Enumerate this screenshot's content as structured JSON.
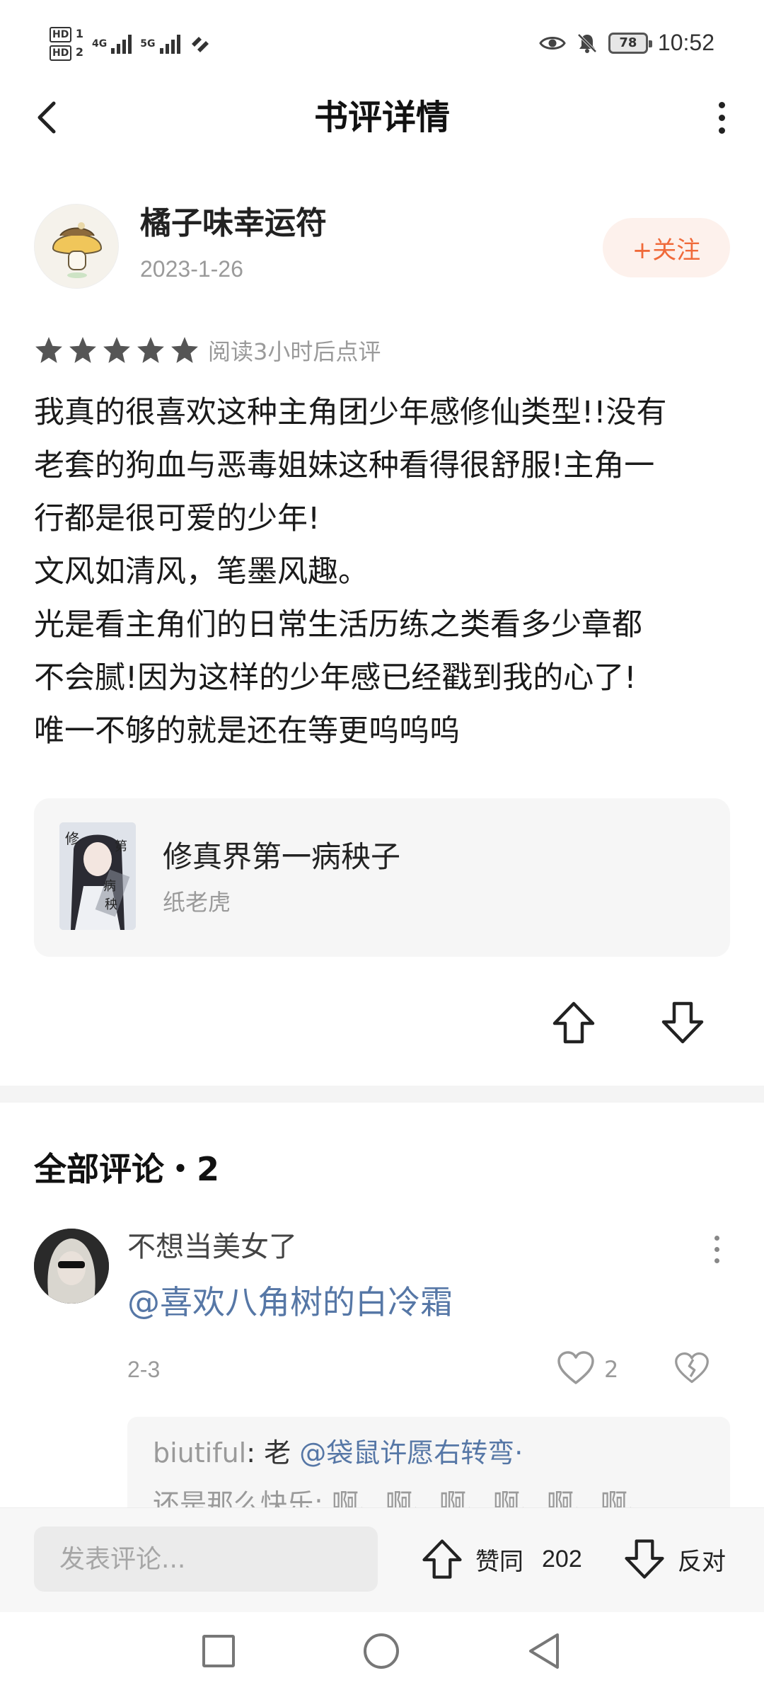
{
  "status_bar": {
    "network_1": "4G",
    "network_2": "5G",
    "battery": "78",
    "time": "10:52"
  },
  "header": {
    "title": "书评详情"
  },
  "review": {
    "author": "橘子味幸运符",
    "date": "2023-1-26",
    "follow_label": "+关注",
    "rating_stars": 5,
    "rating_note": "阅读3小时后点评",
    "lines": [
      "我真的很喜欢这种主角团少年感修仙类型!!没有",
      "老套的狗血与恶毒姐妹这种看得很舒服!主角一",
      "行都是很可爱的少年!",
      "文风如清风，笔墨风趣。",
      "光是看主角们的日常生活历练之类看多少章都",
      "不会腻!因为这样的少年感已经戳到我的心了!",
      "唯一不够的就是还在等更呜呜呜"
    ]
  },
  "book": {
    "title": "修真界第一病秧子",
    "author": "纸老虎"
  },
  "comments": {
    "title": "全部评论・2",
    "items": [
      {
        "user": "不想当美女了",
        "text": "@喜欢八角树的白冷霜",
        "date": "2-3",
        "likes": "2",
        "reply": {
          "user": "biutiful",
          "separator": ": ",
          "prefix": "老 ",
          "mention": "@袋鼠许愿右转弯·",
          "line2": "还是那么快乐: 啊、啊、啊、啊、啊、啊、"
        }
      }
    ]
  },
  "bottom_bar": {
    "input_placeholder": "发表评论...",
    "agree_label": "赞同",
    "agree_count": "202",
    "oppose_label": "反对"
  },
  "colors": {
    "accent": "#f06a3a",
    "follow_bg": "#fdf1ec",
    "mention": "#5677a6",
    "star": "#555555"
  }
}
